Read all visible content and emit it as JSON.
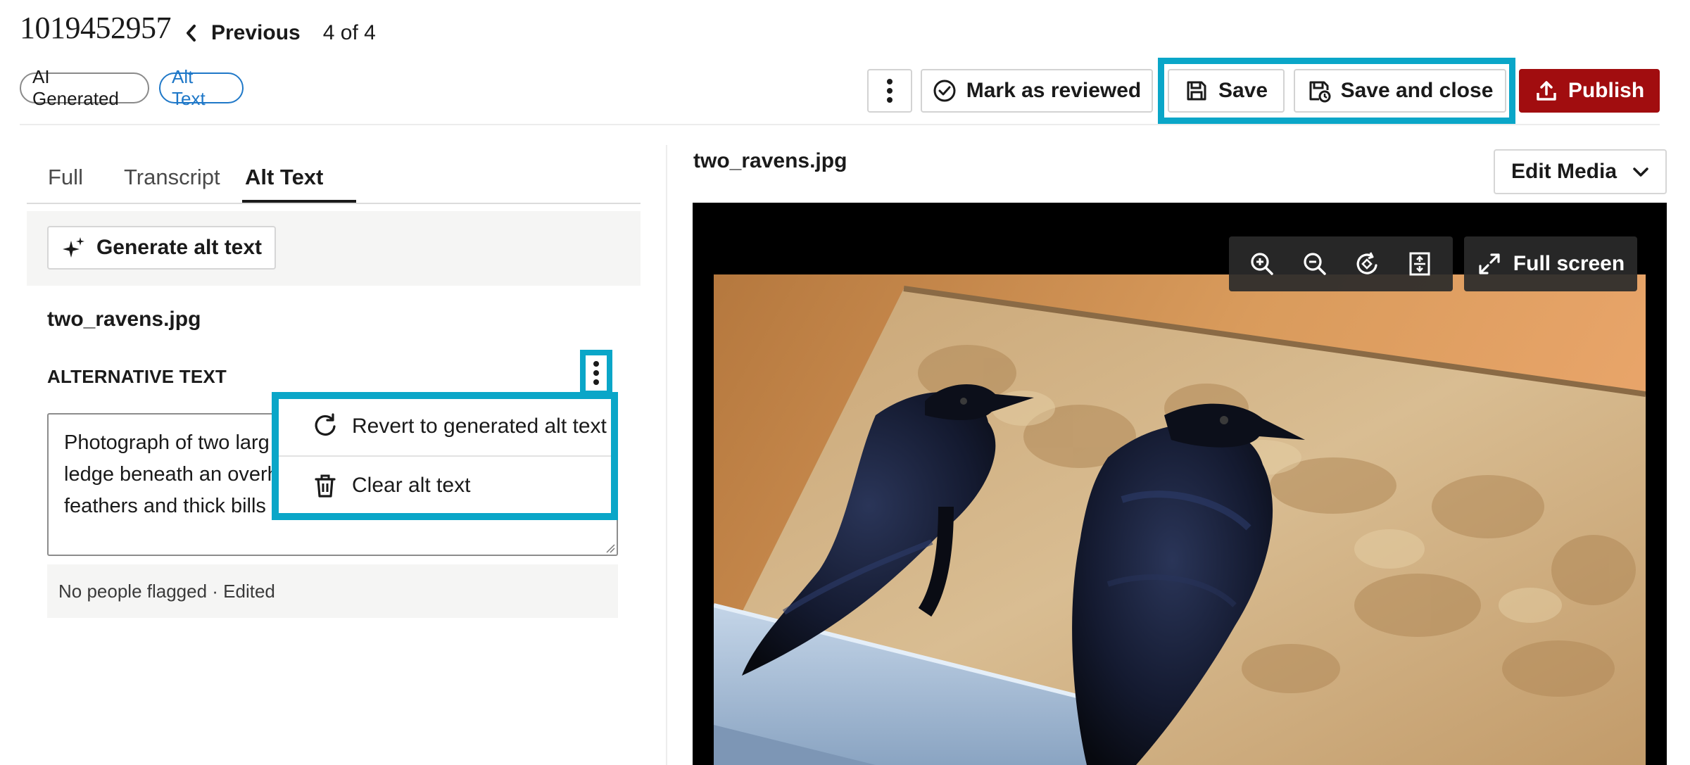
{
  "header": {
    "record_id": "1019452957",
    "previous_label": "Previous",
    "pager": "4 of 4",
    "chips": [
      "AI Generated",
      "Alt Text"
    ]
  },
  "actions": {
    "mark_reviewed_label": "Mark as reviewed",
    "save_label": "Save",
    "save_close_label": "Save and close",
    "publish_label": "Publish"
  },
  "tabs": [
    {
      "label": "Full"
    },
    {
      "label": "Transcript"
    },
    {
      "label": "Alt Text",
      "active": true
    }
  ],
  "left_panel": {
    "generate_label": "Generate alt text",
    "file_name": "two_ravens.jpg",
    "alt_text_heading": "ALTERNATIVE TEXT",
    "alt_text_lines": [
      "Photograph of two larg",
      "ledge beneath an overh",
      "feathers and thick bills"
    ],
    "status": "No people flagged · Edited"
  },
  "menu": {
    "items": [
      {
        "label": "Revert to generated alt text",
        "icon": "revert-icon"
      },
      {
        "label": "Clear alt text",
        "icon": "trash-icon"
      }
    ]
  },
  "right_panel": {
    "file_name": "two_ravens.jpg",
    "edit_media_label": "Edit Media",
    "fullscreen_label": "Full screen",
    "zoom_tools": [
      "zoom-in-icon",
      "zoom-out-icon",
      "rotate-icon",
      "fit-icon"
    ]
  },
  "colors": {
    "highlight": "#0aa6c8",
    "publish": "#a10d0f",
    "chip_alt": "#1f78c8"
  }
}
